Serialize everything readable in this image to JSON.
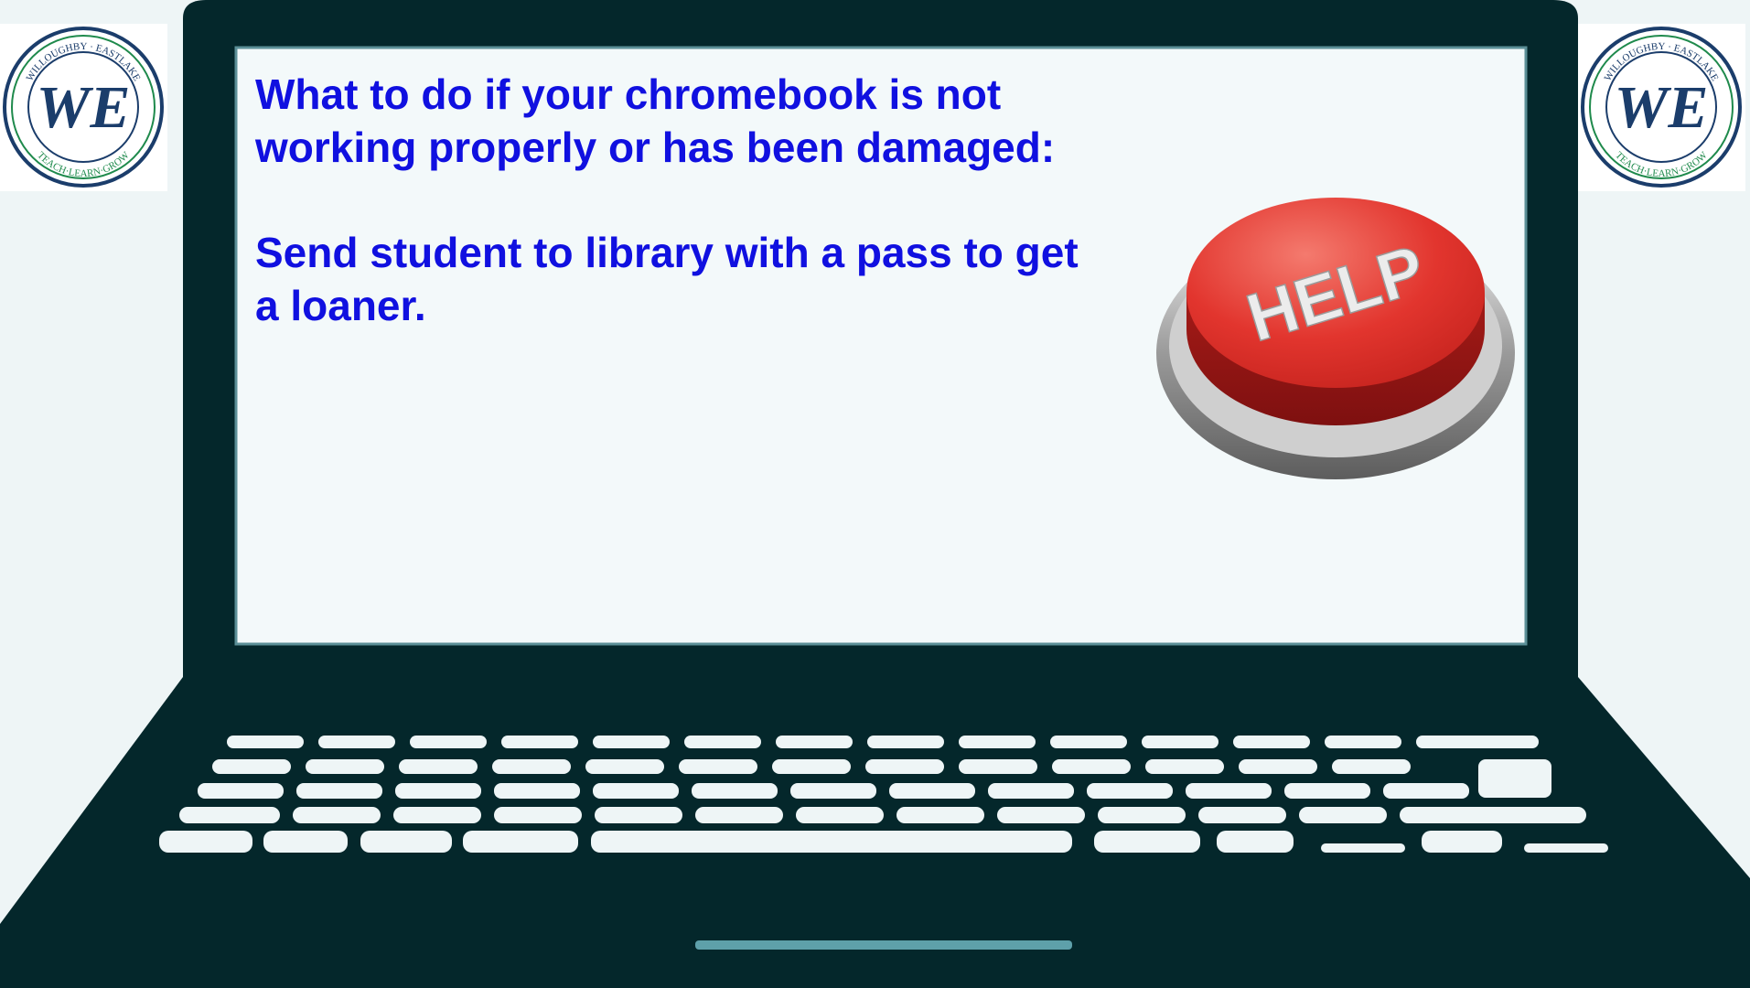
{
  "slide": {
    "heading": "What to do if your chromebook is not working properly or has been damaged:",
    "instruction": "Send student to library with a pass to get a loaner."
  },
  "logo": {
    "top_text": "WILLOUGHBY · EASTLAKE",
    "monogram": "WE",
    "bottom_text": "TEACH·LEARN·GROW"
  },
  "help_button": {
    "label": "HELP"
  },
  "colors": {
    "laptop_body": "#04272b",
    "screen": "#f3f9fa",
    "keys": "#eef5f6",
    "text": "#1010e0",
    "help_red": "#e43a34",
    "logo_navy": "#1b3d6b",
    "logo_green": "#1f8a4c"
  }
}
